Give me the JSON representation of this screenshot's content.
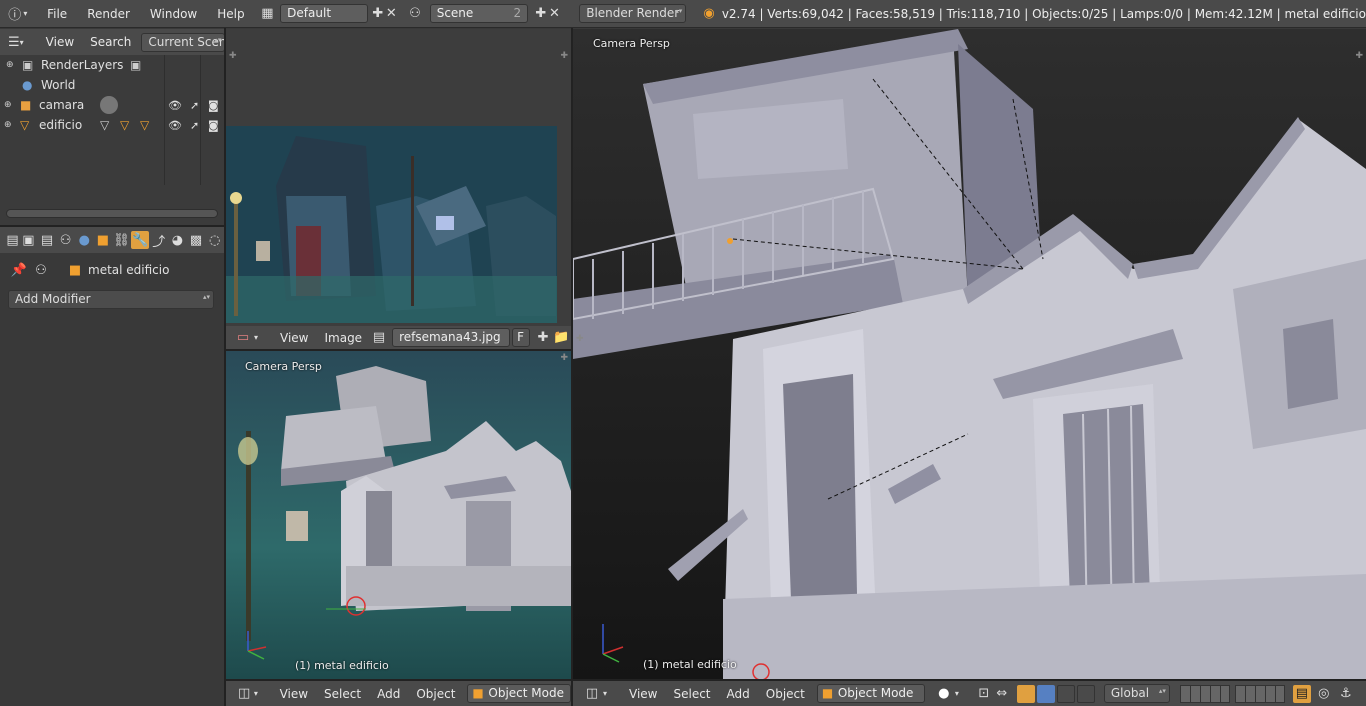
{
  "topbar": {
    "menus": [
      "File",
      "Render",
      "Window",
      "Help"
    ],
    "screen_layout": "Default",
    "scene": "Scene",
    "scene_users": "2",
    "engine": "Blender Render",
    "stats": "v2.74 | Verts:69,042 | Faces:58,519 | Tris:118,710 | Objects:0/25 | Lamps:0/0 | Mem:42.12M | metal edificio"
  },
  "outliner": {
    "menus": [
      "View",
      "Search"
    ],
    "display_mode": "Current Scene",
    "items": [
      {
        "label": "RenderLayers"
      },
      {
        "label": "World"
      },
      {
        "label": "camara"
      },
      {
        "label": "edificio"
      }
    ]
  },
  "properties": {
    "context_name": "metal edificio",
    "add_modifier": "Add Modifier"
  },
  "image_editor": {
    "menus": [
      "View",
      "Image"
    ],
    "image_name": "refsemana43.jpg",
    "fake_user": "F"
  },
  "viewport_small": {
    "label": "Camera Persp",
    "object_info": "(1) metal edificio",
    "menus": [
      "View",
      "Select",
      "Add",
      "Object"
    ],
    "mode": "Object Mode"
  },
  "viewport_main": {
    "label": "Camera Persp",
    "object_info": "(1) metal edificio",
    "menus": [
      "View",
      "Select",
      "Add",
      "Object"
    ],
    "mode": "Object Mode",
    "orientation": "Global"
  },
  "colors": {
    "header": "#4a4a4a",
    "panel": "#393939",
    "accent": "#f0a030",
    "selected": "#5680c2"
  }
}
